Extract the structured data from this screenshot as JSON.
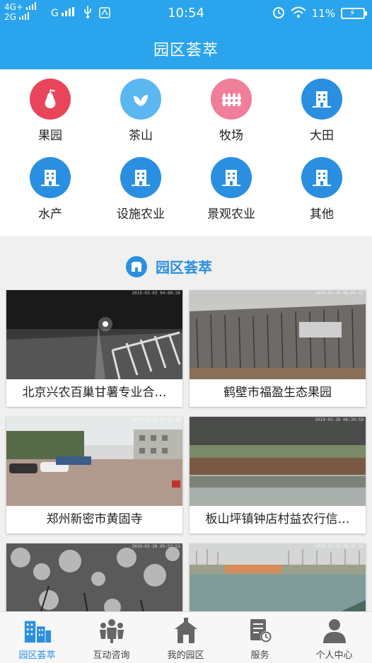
{
  "status_bar": {
    "network_1": "4G+",
    "network_2": "2G",
    "network_3": "G",
    "time": "10:54",
    "battery": "11%"
  },
  "header": {
    "title": "园区荟萃"
  },
  "categories": [
    {
      "label": "果园",
      "icon": "pear-icon",
      "color": "#e8455a"
    },
    {
      "label": "茶山",
      "icon": "tea-leaf-icon",
      "color": "#5ab7f0"
    },
    {
      "label": "牧场",
      "icon": "fence-icon",
      "color": "#f07e9a"
    },
    {
      "label": "大田",
      "icon": "building-icon",
      "color": "#2a8fe0"
    },
    {
      "label": "水产",
      "icon": "building-icon",
      "color": "#2a8fe0"
    },
    {
      "label": "设施农业",
      "icon": "building-icon",
      "color": "#2a8fe0"
    },
    {
      "label": "景观农业",
      "icon": "building-icon",
      "color": "#2a8fe0"
    },
    {
      "label": "其他",
      "icon": "building-icon",
      "color": "#2a8fe0"
    }
  ],
  "section": {
    "title": "园区荟萃",
    "icon": "shop-icon"
  },
  "cards": [
    {
      "label": "北京兴农百巢甘薯专业合…",
      "stamp": "2019-03-03 04:08:28"
    },
    {
      "label": "鹤壁市福盈生态果园",
      "stamp": "2019-03-26 06:05:42"
    },
    {
      "label": "郑州新密市黄固寺",
      "stamp": "2019-03-26 06:54:41"
    },
    {
      "label": "板山坪镇钟店村益农行信…",
      "stamp": "2019-03-26 06:30:59"
    },
    {
      "label": "",
      "stamp": "2019-03-26 05:52:51"
    },
    {
      "label": "",
      "stamp": "2019-03-26 06:42:39"
    }
  ],
  "bottom_nav": [
    {
      "label": "园区荟萃",
      "icon": "buildings-icon",
      "active": true
    },
    {
      "label": "互动咨询",
      "icon": "people-icon",
      "active": false
    },
    {
      "label": "我的园区",
      "icon": "house-icon",
      "active": false
    },
    {
      "label": "服务",
      "icon": "document-clock-icon",
      "active": false
    },
    {
      "label": "个人中心",
      "icon": "person-icon",
      "active": false
    }
  ],
  "colors": {
    "primary": "#2aa4ec",
    "accent": "#2a8fe0"
  }
}
